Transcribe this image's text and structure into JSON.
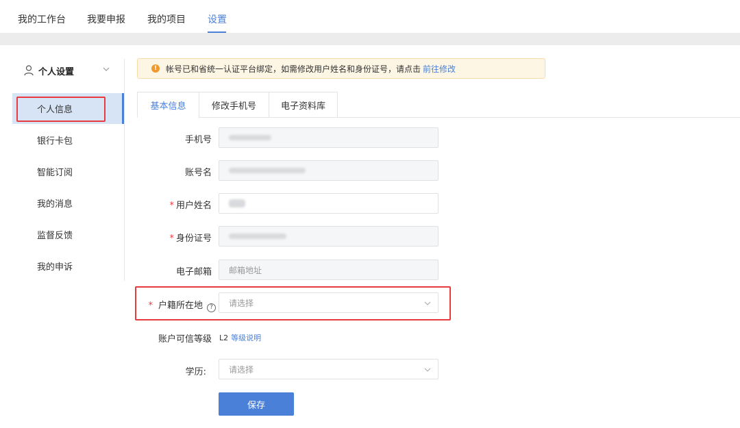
{
  "topnav": {
    "items": [
      {
        "label": "我的工作台"
      },
      {
        "label": "我要申报"
      },
      {
        "label": "我的项目"
      },
      {
        "label": "设置"
      }
    ]
  },
  "sidebar": {
    "header": "个人设置",
    "items": [
      {
        "label": "个人信息",
        "active": true
      },
      {
        "label": "银行卡包"
      },
      {
        "label": "智能订阅"
      },
      {
        "label": "我的消息"
      },
      {
        "label": "监督反馈"
      },
      {
        "label": "我的申诉"
      }
    ]
  },
  "notice": {
    "text": "帐号已和省统一认证平台绑定，如需修改用户姓名和身份证号，请点击",
    "link": "前往修改"
  },
  "tabs": [
    {
      "label": "基本信息",
      "active": true
    },
    {
      "label": "修改手机号"
    },
    {
      "label": "电子资料库"
    }
  ],
  "form": {
    "phone_label": "手机号",
    "account_label": "账号名",
    "name_label": "用户姓名",
    "idcard_label": "身份证号",
    "email_label": "电子邮箱",
    "email_placeholder": "邮箱地址",
    "household_label": "户籍所在地",
    "household_placeholder": "请选择",
    "level_label": "账户可信等级",
    "level_value": "L2",
    "level_link": "等级说明",
    "education_label": "学历:",
    "education_placeholder": "请选择",
    "required_mark": "*",
    "save_label": "保存"
  },
  "colors": {
    "accent": "#4a80d8",
    "highlight": "#e8393f",
    "notice_bg": "#fdf6e4",
    "notice_icon": "#f09a2e"
  }
}
